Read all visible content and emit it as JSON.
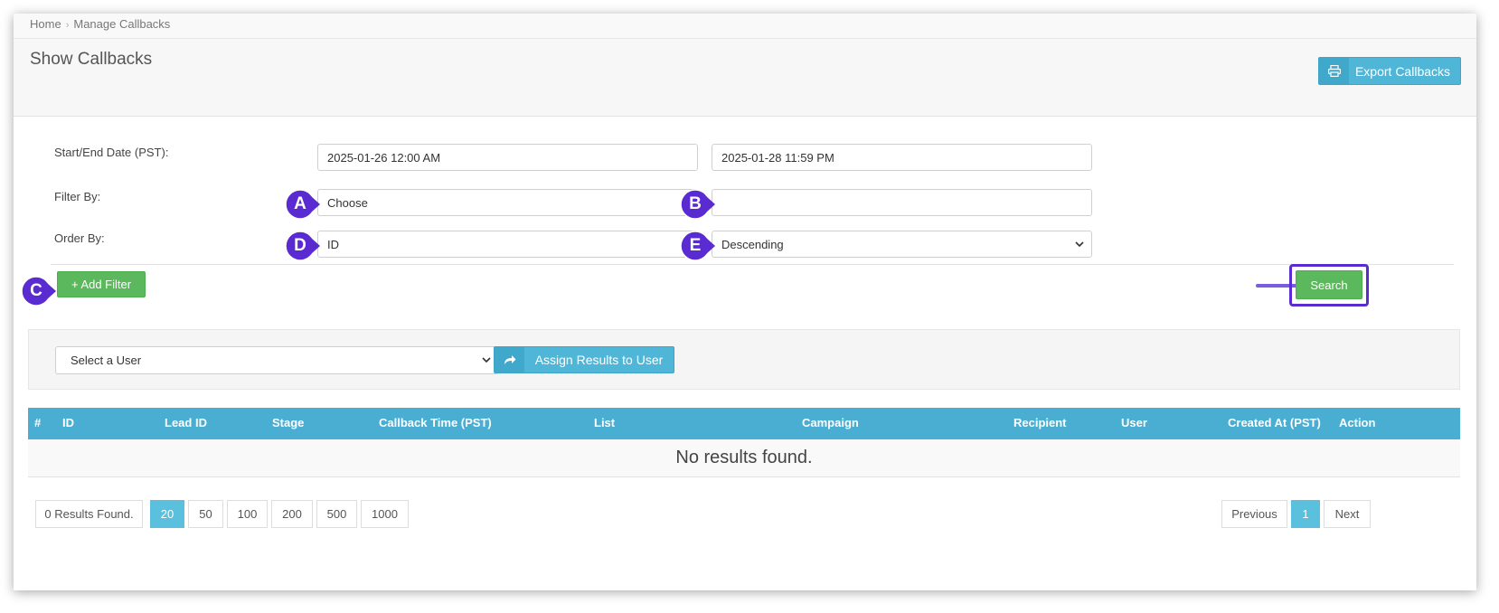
{
  "breadcrumb": {
    "home": "Home",
    "separator": "›",
    "current": "Manage Callbacks"
  },
  "header": {
    "title": "Show Callbacks",
    "export_label": "Export Callbacks",
    "export_icon": "printer-icon"
  },
  "form": {
    "date_label": "Start/End Date (PST):",
    "start_date": "2025-01-26 12:00 AM",
    "end_date": "2025-01-28 11:59 PM",
    "filter_label": "Filter By:",
    "filter_field": "Choose",
    "filter_value": "",
    "order_label": "Order By:",
    "order_field": "ID",
    "order_direction": "Descending",
    "add_filter_label": "+ Add Filter",
    "search_label": "Search"
  },
  "markers": {
    "a": "A",
    "b": "B",
    "c": "C",
    "d": "D",
    "e": "E"
  },
  "assign": {
    "user_select": "Select a User",
    "assign_label": "Assign Results to User",
    "assign_icon": "share-arrow-icon"
  },
  "table": {
    "columns": [
      "#",
      "ID",
      "Lead ID",
      "Stage",
      "Callback Time (PST)",
      "List",
      "Campaign",
      "Recipient",
      "User",
      "Created At (PST)",
      "Action"
    ],
    "empty_message": "No results found."
  },
  "pagination": {
    "results_found": "0 Results Found.",
    "page_sizes": [
      "20",
      "50",
      "100",
      "200",
      "500",
      "1000"
    ],
    "active_size": "20",
    "previous": "Previous",
    "current_page": "1",
    "next": "Next"
  },
  "colors": {
    "accent_blue": "#4aaed2",
    "success_green": "#5cb85c",
    "annotation_purple": "#5a2bd0"
  }
}
